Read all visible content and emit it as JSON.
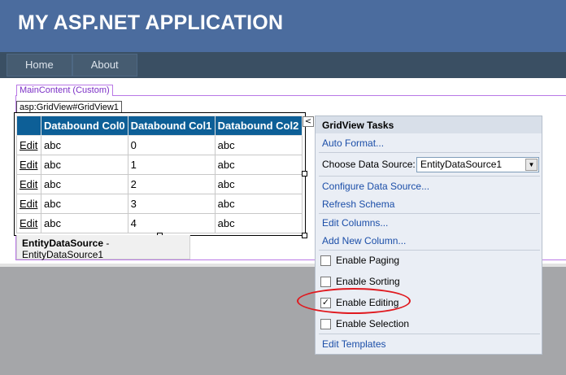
{
  "app": {
    "title": "MY ASP.NET APPLICATION"
  },
  "nav": {
    "items": [
      {
        "label": "Home"
      },
      {
        "label": "About"
      }
    ]
  },
  "designer": {
    "content_label": "MainContent (Custom)",
    "grid_tag": "asp:GridView#GridView1"
  },
  "grid": {
    "headers": [
      "",
      "Databound Col0",
      "Databound Col1",
      "Databound Col2"
    ],
    "rows": [
      [
        "Edit",
        "abc",
        "0",
        "abc"
      ],
      [
        "Edit",
        "abc",
        "1",
        "abc"
      ],
      [
        "Edit",
        "abc",
        "2",
        "abc"
      ],
      [
        "Edit",
        "abc",
        "3",
        "abc"
      ],
      [
        "Edit",
        "abc",
        "4",
        "abc"
      ]
    ]
  },
  "datasource_box": {
    "type": "EntityDataSource",
    "separator": " - ",
    "name": "EntityDataSource1"
  },
  "smart_tag": {
    "glyph": "<"
  },
  "tasks": {
    "title": "GridView Tasks",
    "auto_format": "Auto Format...",
    "choose_ds_label": "Choose Data Source:",
    "choose_ds_value": "EntityDataSource1",
    "dropdown_glyph": "▼",
    "configure_ds": "Configure Data Source...",
    "refresh_schema": "Refresh Schema",
    "edit_columns": "Edit Columns...",
    "add_column": "Add New Column...",
    "options": [
      {
        "label": "Enable Paging",
        "checked": false,
        "mark": ""
      },
      {
        "label": "Enable Sorting",
        "checked": false,
        "mark": ""
      },
      {
        "label": "Enable Editing",
        "checked": true,
        "mark": "✓"
      },
      {
        "label": "Enable Selection",
        "checked": false,
        "mark": ""
      }
    ],
    "edit_templates": "Edit Templates"
  },
  "colors": {
    "header_bg": "#4b6c9e",
    "nav_bg": "#3a4f63",
    "grid_header_bg": "#0d5f97",
    "task_link": "#1b4ea8",
    "highlight": "#e0191f"
  }
}
